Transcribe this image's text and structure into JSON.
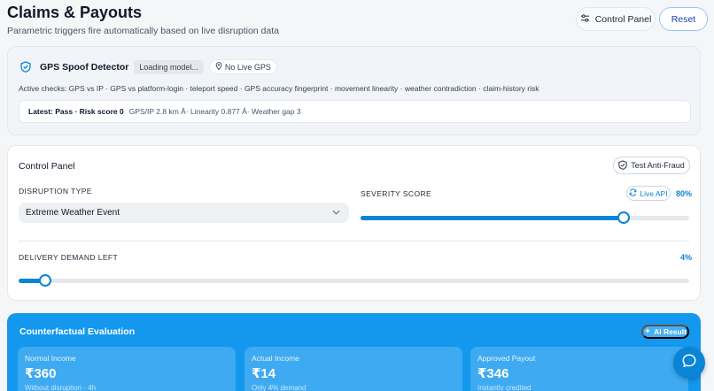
{
  "header": {
    "title": "Claims & Payouts",
    "subtitle": "Parametric triggers fire automatically based on live disruption data",
    "control_panel_label": "Control Panel",
    "reset_label": "Reset"
  },
  "gps": {
    "title": "GPS Spoof Detector",
    "model_status": "Loading model...",
    "gps_status": "No Live GPS",
    "active_checks": "Active checks: GPS vs IP · GPS vs platform-login · teleport speed · GPS accuracy fingerprint · movement linearity · weather contradiction · claim-history risk",
    "latest_label": "Latest: Pass · Risk score 0",
    "latest_detail": "GPS/IP 2.8 km Â· Linearity 0.877 Â· Weather gap 3"
  },
  "control_panel": {
    "title": "Control Panel",
    "test_fraud_label": "Test Anti-Fraud",
    "disruption_type_label": "DISRUPTION TYPE",
    "disruption_type_value": "Extreme Weather Event",
    "severity_label": "SEVERITY SCORE",
    "live_api_label": "Live API",
    "severity_pct_text": "80%",
    "severity_value": 0.8,
    "demand_label": "DELIVERY DEMAND LEFT",
    "demand_pct_text": "4%",
    "demand_value": 0.04
  },
  "evaluation": {
    "title": "Counterfactual Evaluation",
    "ai_result_label": "AI Result",
    "stats": [
      {
        "label": "Normal Income",
        "value": "₹360",
        "note": "Without disruption · 4h"
      },
      {
        "label": "Actual Income",
        "value": "₹14",
        "note": "Only 4% demand"
      },
      {
        "label": "Approved Payout",
        "value": "₹346",
        "note": "Instantly credited"
      }
    ]
  },
  "colors": {
    "accent": "#0a84d6",
    "eval_bg": "#1498ee"
  },
  "icons": {
    "control_panel": "sliders-icon",
    "gps": "shield-check-icon",
    "location": "map-pin-icon",
    "fraud": "shield-icon",
    "live_api": "refresh-icon",
    "ai": "sparkle-icon",
    "chat": "chat-bubble-icon",
    "select": "chevron-down-icon"
  }
}
